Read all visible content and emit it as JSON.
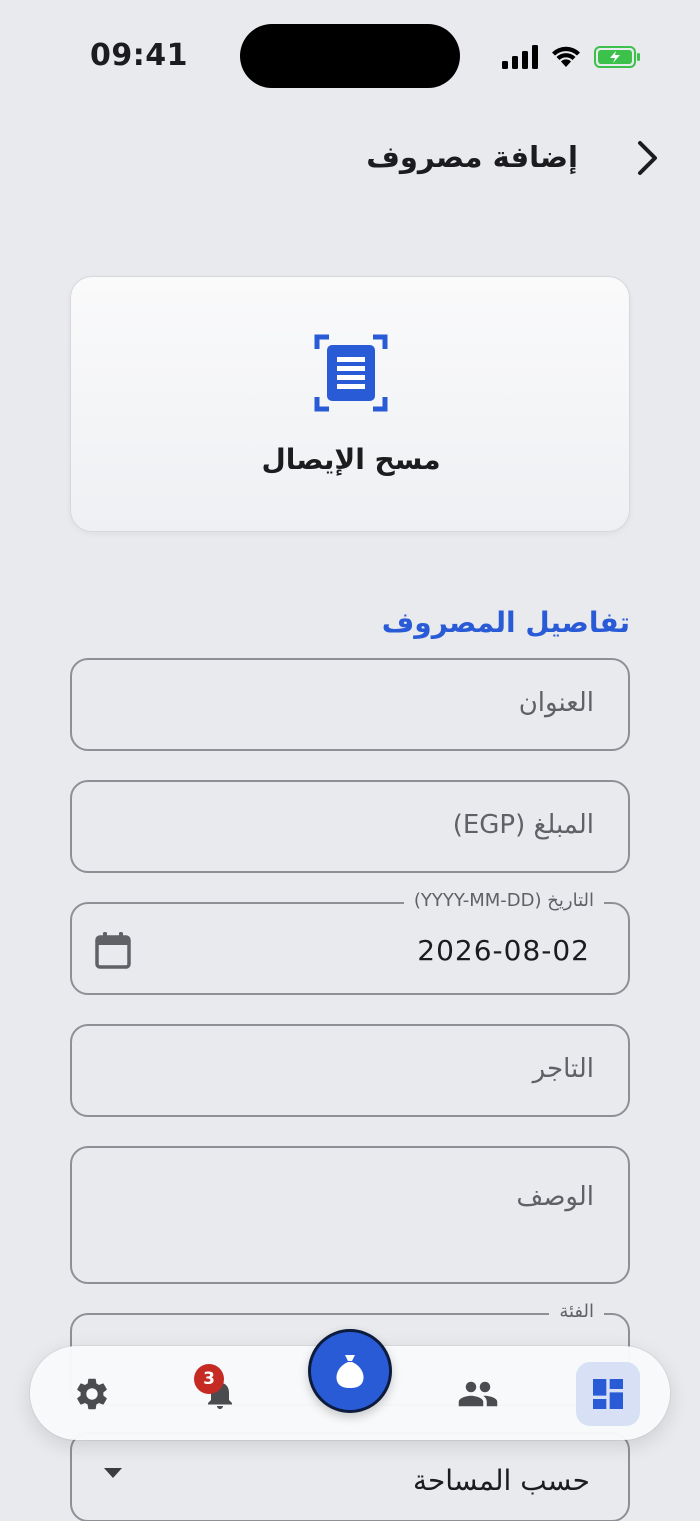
{
  "status_bar": {
    "time": "09:41"
  },
  "header": {
    "title": "إضافة مصروف"
  },
  "scan_card": {
    "label": "مسح الإيصال"
  },
  "form": {
    "section_title": "تفاصيل المصروف",
    "title_placeholder": "العنوان",
    "amount_placeholder": "المبلغ (EGP)",
    "date_label": "التاريخ (YYYY-MM-DD)",
    "date_value": "2026-08-02",
    "merchant_placeholder": "التاجر",
    "description_placeholder": "الوصف",
    "category_label": "الفئة",
    "split_value": "حسب المساحة"
  },
  "bottom_nav": {
    "notifications_count": "3",
    "items": [
      "settings-icon",
      "bell-icon",
      "add-icon",
      "people-icon",
      "dashboard-icon"
    ]
  },
  "colors": {
    "accent": "#2a5bd7",
    "background": "#e8eaee",
    "badge": "#c62b23"
  }
}
